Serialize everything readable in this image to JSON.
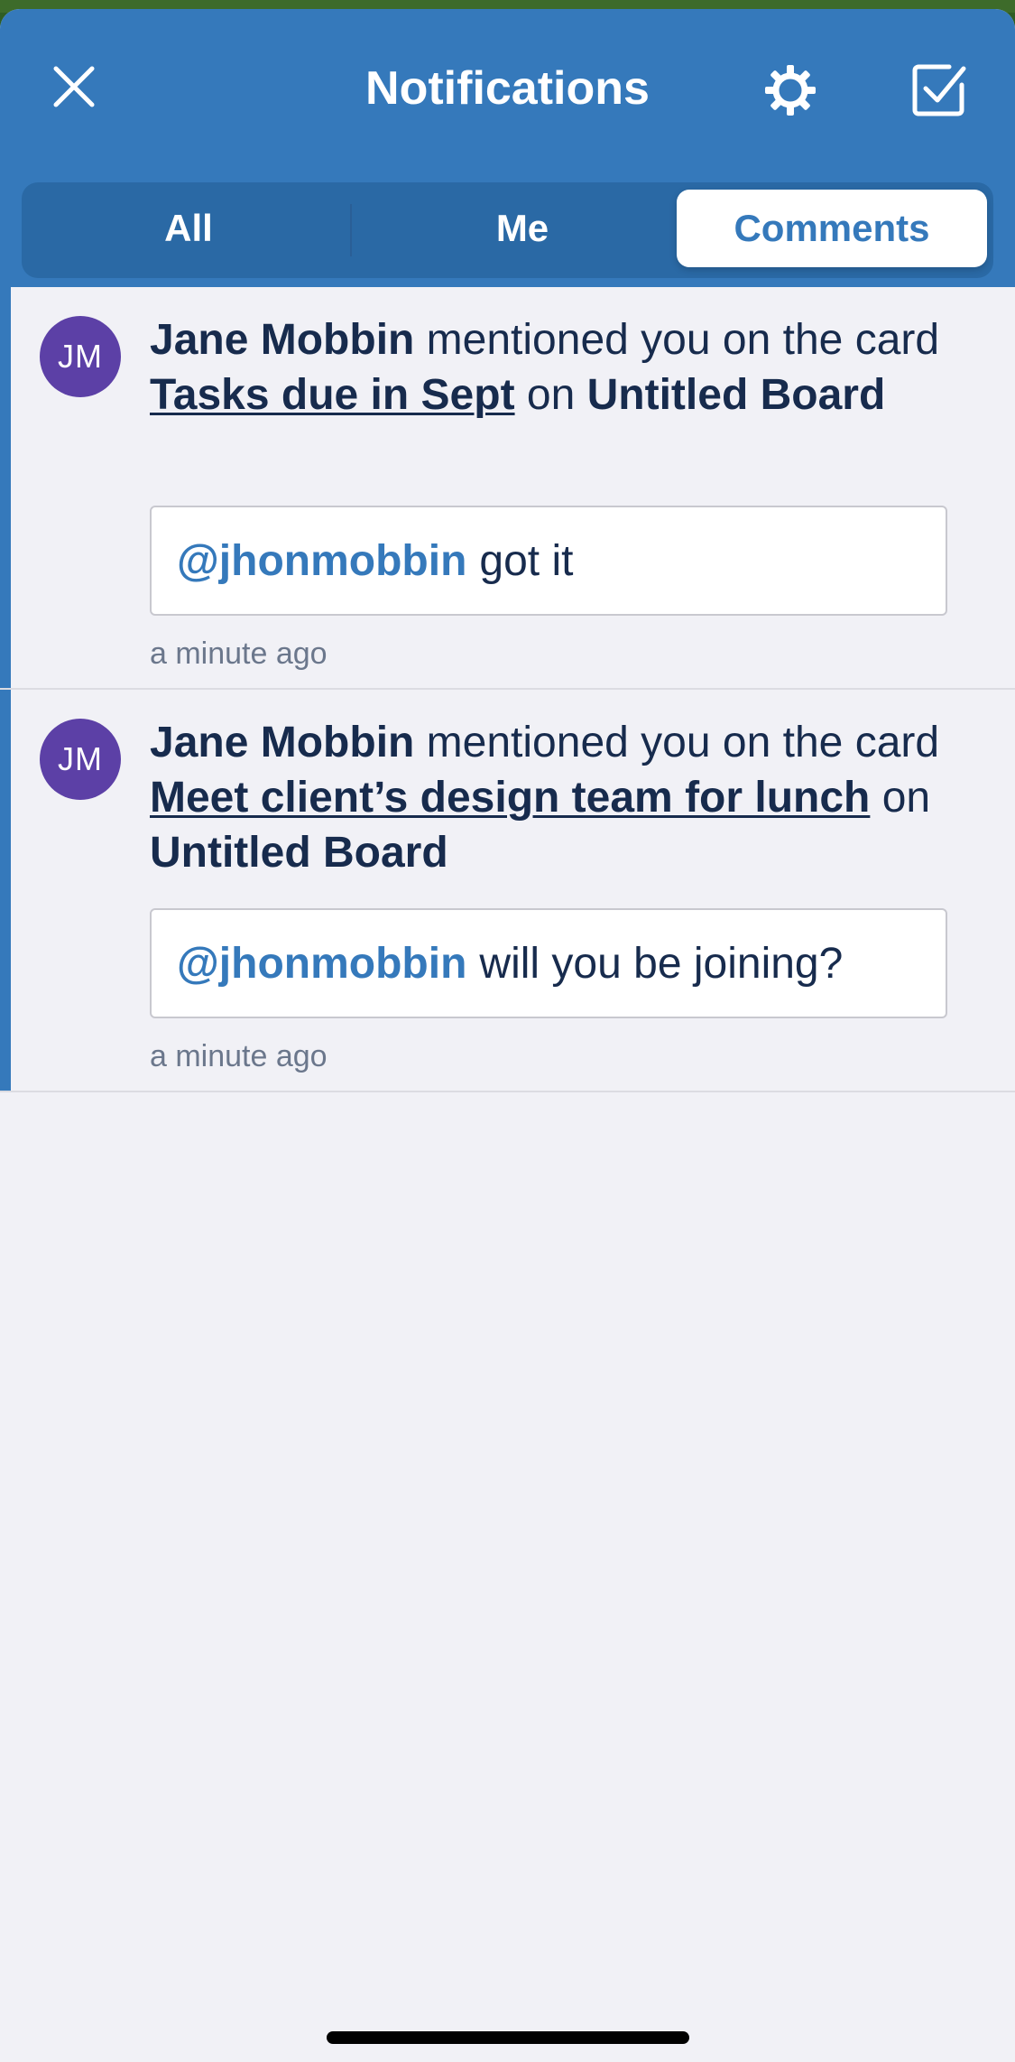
{
  "header": {
    "title": "Notifications",
    "close_icon": "close-icon",
    "settings_icon": "gear-icon",
    "mark_all_read_icon": "checkbox-icon"
  },
  "tabs": [
    {
      "label": "All",
      "selected": false
    },
    {
      "label": "Me",
      "selected": false
    },
    {
      "label": "Comments",
      "selected": true
    }
  ],
  "notifications": [
    {
      "avatar_initials": "JM",
      "actor": "Jane Mobbin",
      "action": " mentioned you on the card ",
      "card": "Tasks due in Sept",
      "connector": " on ",
      "board": "Untitled Board",
      "mention": "@jhonmobbin",
      "comment": "got it",
      "time": "a minute ago",
      "unread": true
    },
    {
      "avatar_initials": "JM",
      "actor": "Jane Mobbin",
      "action": " mentioned you on the card ",
      "card": "Meet client’s design team for lunch",
      "connector": " on ",
      "board": "Untitled Board",
      "mention": "@jhonmobbin",
      "comment": "will you be joining?",
      "time": "a minute ago",
      "unread": true
    }
  ],
  "colors": {
    "header_bg": "#3579bb",
    "segment_bg": "#2a69a5",
    "avatar_bg": "#5c40a6",
    "text_primary": "#172b4d",
    "text_secondary": "#6b778c",
    "page_bg": "#f1f1f6"
  }
}
